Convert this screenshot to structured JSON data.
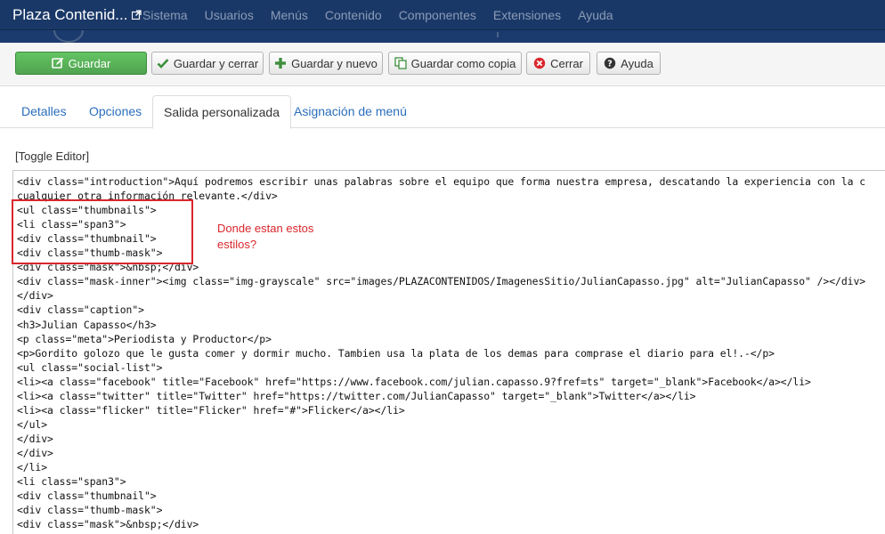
{
  "navbar": {
    "brand": "Plaza Contenid...",
    "menu": [
      "Sistema",
      "Usuarios",
      "Menús",
      "Contenido",
      "Componentes",
      "Extensiones",
      "Ayuda"
    ]
  },
  "toolbar": {
    "save": "Guardar",
    "save_close": "Guardar y cerrar",
    "save_new": "Guardar y nuevo",
    "save_copy": "Guardar como copia",
    "close": "Cerrar",
    "help": "Ayuda"
  },
  "tabs": {
    "details": "Detalles",
    "options": "Opciones",
    "custom_output": "Salida personalizada",
    "menu_assignment": "Asignación de menú"
  },
  "toggle_editor": "[Toggle Editor]",
  "code_lines": [
    "<div class=\"introduction\">Aquí podremos escribir unas palabras sobre el equipo que forma nuestra empresa, descatando la experiencia con la c",
    "cualquier otra información relevante.</div>",
    "<ul class=\"thumbnails\">",
    "<li class=\"span3\">",
    "<div class=\"thumbnail\">",
    "<div class=\"thumb-mask\">",
    "<div class=\"mask\">&nbsp;</div>",
    "<div class=\"mask-inner\"><img class=\"img-grayscale\" src=\"images/PLAZACONTENIDOS/ImagenesSitio/JulianCapasso.jpg\" alt=\"JulianCapasso\" /></div>",
    "</div>",
    "<div class=\"caption\">",
    "<h3>Julian Capasso</h3>",
    "<p class=\"meta\">Periodista y Productor</p>",
    "<p>Gordito golozo que le gusta comer y dormir mucho. Tambien usa la plata de los demas para comprase el diario para el!.-</p>",
    "<ul class=\"social-list\">",
    "<li><a class=\"facebook\" title=\"Facebook\" href=\"https://www.facebook.com/julian.capasso.9?fref=ts\" target=\"_blank\">Facebook</a></li>",
    "<li><a class=\"twitter\" title=\"Twitter\" href=\"https://twitter.com/JulianCapasso\" target=\"_blank\">Twitter</a></li>",
    "<li><a class=\"flicker\" title=\"Flicker\" href=\"#\">Flicker</a></li>",
    "</ul>",
    "</div>",
    "</div>",
    "</li>",
    "<li class=\"span3\">",
    "<div class=\"thumbnail\">",
    "<div class=\"thumb-mask\">",
    "<div class=\"mask\">&nbsp;</div>"
  ],
  "annotation": "Donde estan estos estilos?",
  "colors": {
    "navbar_bg": "#1a3867",
    "save_green": "#51a351",
    "link_blue": "#2a6ebb",
    "annotation_red": "#d9262c"
  }
}
